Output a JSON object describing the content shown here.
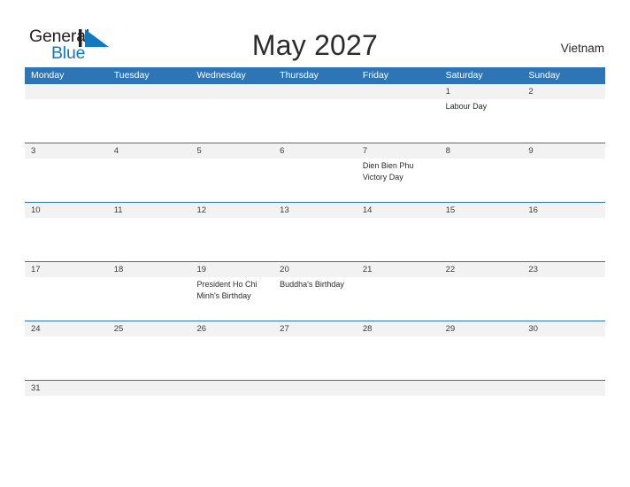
{
  "brand": {
    "name_part1": "General",
    "name_part2": "Blue",
    "mark_color": "#1279c0",
    "text_color": "#231f20"
  },
  "header": {
    "title": "May 2027",
    "country": "Vietnam",
    "accent_color": "#2e75b6",
    "band_color": "#f2f2f2"
  },
  "weekdays": [
    "Monday",
    "Tuesday",
    "Wednesday",
    "Thursday",
    "Friday",
    "Saturday",
    "Sunday"
  ],
  "weeks": [
    {
      "days": [
        {
          "num": "",
          "event": ""
        },
        {
          "num": "",
          "event": ""
        },
        {
          "num": "",
          "event": ""
        },
        {
          "num": "",
          "event": ""
        },
        {
          "num": "",
          "event": ""
        },
        {
          "num": "1",
          "event": "Labour Day"
        },
        {
          "num": "2",
          "event": ""
        }
      ]
    },
    {
      "days": [
        {
          "num": "3",
          "event": ""
        },
        {
          "num": "4",
          "event": ""
        },
        {
          "num": "5",
          "event": ""
        },
        {
          "num": "6",
          "event": ""
        },
        {
          "num": "7",
          "event": "Dien Bien Phu Victory Day"
        },
        {
          "num": "8",
          "event": ""
        },
        {
          "num": "9",
          "event": ""
        }
      ]
    },
    {
      "days": [
        {
          "num": "10",
          "event": ""
        },
        {
          "num": "11",
          "event": ""
        },
        {
          "num": "12",
          "event": ""
        },
        {
          "num": "13",
          "event": ""
        },
        {
          "num": "14",
          "event": ""
        },
        {
          "num": "15",
          "event": ""
        },
        {
          "num": "16",
          "event": ""
        }
      ]
    },
    {
      "days": [
        {
          "num": "17",
          "event": ""
        },
        {
          "num": "18",
          "event": ""
        },
        {
          "num": "19",
          "event": "President Ho Chi Minh's Birthday"
        },
        {
          "num": "20",
          "event": "Buddha's Birthday"
        },
        {
          "num": "21",
          "event": ""
        },
        {
          "num": "22",
          "event": ""
        },
        {
          "num": "23",
          "event": ""
        }
      ]
    },
    {
      "days": [
        {
          "num": "24",
          "event": ""
        },
        {
          "num": "25",
          "event": ""
        },
        {
          "num": "26",
          "event": ""
        },
        {
          "num": "27",
          "event": ""
        },
        {
          "num": "28",
          "event": ""
        },
        {
          "num": "29",
          "event": ""
        },
        {
          "num": "30",
          "event": ""
        }
      ]
    },
    {
      "short": true,
      "days": [
        {
          "num": "31",
          "event": ""
        },
        {
          "num": "",
          "event": ""
        },
        {
          "num": "",
          "event": ""
        },
        {
          "num": "",
          "event": ""
        },
        {
          "num": "",
          "event": ""
        },
        {
          "num": "",
          "event": ""
        },
        {
          "num": "",
          "event": ""
        }
      ]
    }
  ]
}
